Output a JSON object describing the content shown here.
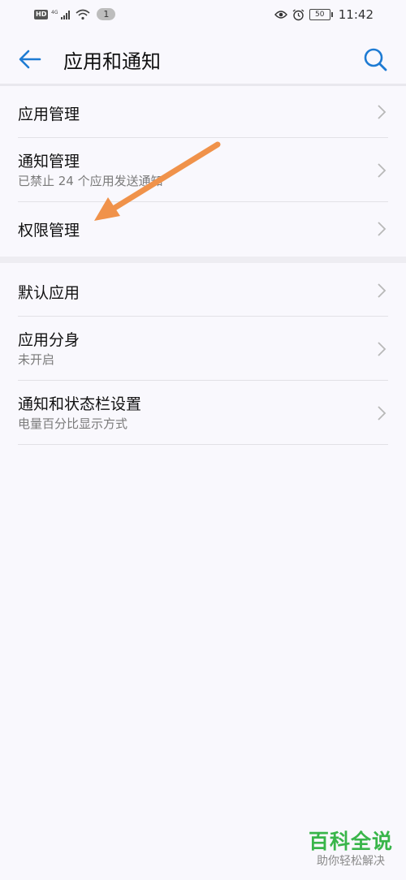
{
  "status_bar": {
    "hd": "HD",
    "network": "4G",
    "notification_count": "1",
    "battery": "50",
    "time": "11:42"
  },
  "app_bar": {
    "title": "应用和通知"
  },
  "groups": [
    {
      "items": [
        {
          "title": "应用管理",
          "subtitle": ""
        },
        {
          "title": "通知管理",
          "subtitle": "已禁止 24 个应用发送通知"
        },
        {
          "title": "权限管理",
          "subtitle": ""
        }
      ]
    },
    {
      "items": [
        {
          "title": "默认应用",
          "subtitle": ""
        },
        {
          "title": "应用分身",
          "subtitle": "未开启"
        },
        {
          "title": "通知和状态栏设置",
          "subtitle": "电量百分比显示方式"
        }
      ]
    }
  ],
  "watermark": {
    "title": "百科全说",
    "subtitle": "助你轻松解决"
  },
  "colors": {
    "accent": "#1e7bd3",
    "arrow": "#f0924a",
    "watermark": "#39b54a"
  }
}
